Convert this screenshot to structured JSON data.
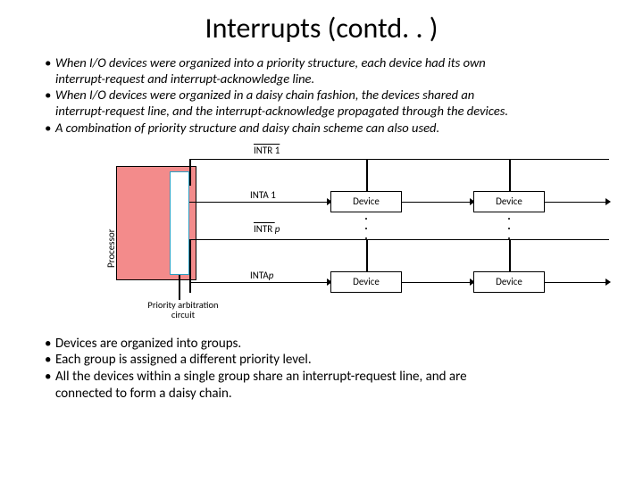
{
  "title": "Interrupts (contd. . )",
  "top": {
    "b1": "When I/O devices were organized into a priority structure, each device had its own",
    "b1c": "interrupt-request and interrupt-acknowledge line.",
    "b2": "When I/O devices were organized in a daisy chain fashion, the devices shared an",
    "b2c": "interrupt-request line, and the interrupt-acknowledge propagated through the devices.",
    "b3": "A combination of priority structure and daisy chain scheme can also used."
  },
  "diagram": {
    "processor": "Processor",
    "intr1": "INTR 1",
    "inta1": "INTA 1",
    "intrp_pre": "INTR ",
    "intrp_p": "p",
    "intap_pre": "INTA",
    "intap_p": "p",
    "device": "Device",
    "pac1": "Priority arbitration",
    "pac2": "circuit"
  },
  "bottom": {
    "b1": "Devices are organized into groups.",
    "b2": "Each group is assigned a different priority level.",
    "b3": "All the devices within a single group share an interrupt-request line, and are",
    "b3c": "connected to form a daisy chain."
  }
}
